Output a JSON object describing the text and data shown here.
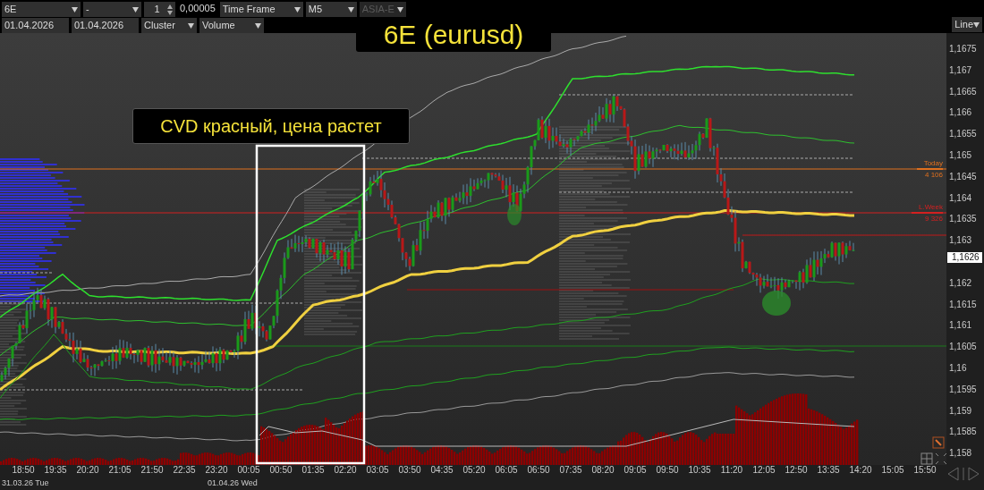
{
  "toolbar": {
    "row_1": [
      {
        "kind": "select",
        "value": "6E",
        "disabled": false
      },
      {
        "kind": "select",
        "value": "-",
        "disabled": false
      },
      {
        "kind": "spinner",
        "value": "1",
        "disabled": false
      },
      {
        "kind": "field",
        "value": "0,00005",
        "disabled": false
      },
      {
        "kind": "select",
        "value": "Time Frame",
        "disabled": false
      },
      {
        "kind": "select",
        "value": "M5",
        "disabled": false
      },
      {
        "kind": "select",
        "value": "ASIA-E",
        "disabled": true
      }
    ],
    "row_2": [
      {
        "kind": "field",
        "value": "01.04.2026"
      },
      {
        "kind": "field",
        "value": "01.04.2026"
      },
      {
        "kind": "select",
        "value": "Cluster"
      },
      {
        "kind": "select",
        "value": "Volume"
      }
    ],
    "chart_type": "Line"
  },
  "title_banner": "6E (eurusd)",
  "annotation": "CVD красный, цена растет",
  "levels": [
    {
      "label": "Today",
      "value": "4 106",
      "color": "#e0701e"
    },
    {
      "label": "L.Week",
      "value": "9 326",
      "color": "#d42020"
    }
  ],
  "price_axis": [
    "1,1675",
    "1,167",
    "1,1665",
    "1,166",
    "1,1655",
    "1,165",
    "1,1645",
    "1,164",
    "1,1635",
    "1,163",
    "1,162",
    "1,1615",
    "1,161",
    "1,1605",
    "1,16",
    "1,1595",
    "1,159",
    "1,1585",
    "1,158"
  ],
  "last_price": "1,1626",
  "time_axis": [
    "18:50",
    "19:35",
    "20:20",
    "21:05",
    "21:50",
    "22:35",
    "23:20",
    "00:05",
    "00:50",
    "01:35",
    "02:20",
    "03:05",
    "03:50",
    "04:35",
    "05:20",
    "06:05",
    "06:50",
    "07:35",
    "08:20",
    "09:05",
    "09:50",
    "10:35",
    "11:20",
    "12:05",
    "12:50",
    "13:35",
    "14:20",
    "15:05",
    "15:50"
  ],
  "dates": [
    "31.03.26 Tue",
    "01.04.26 Wed"
  ]
}
